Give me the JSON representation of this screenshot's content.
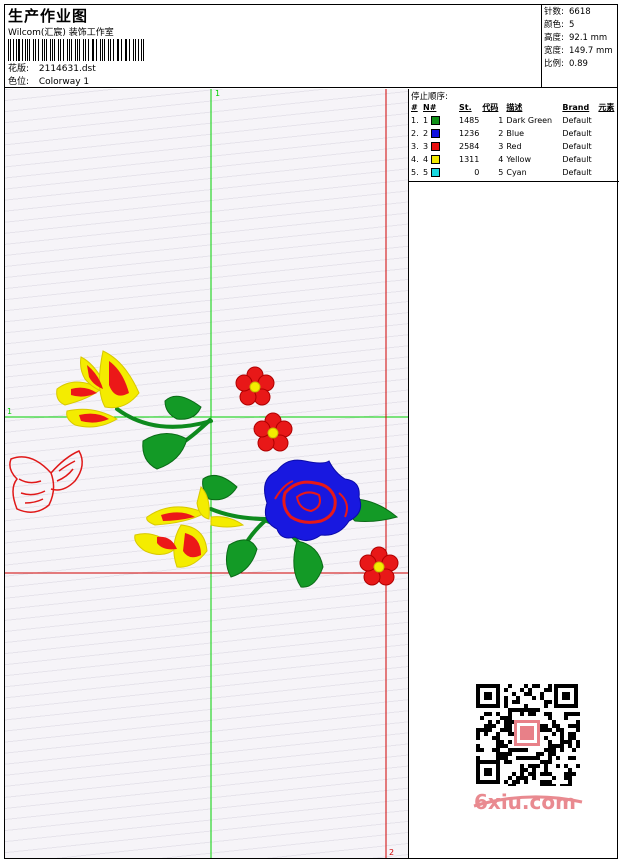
{
  "header": {
    "title": "生产作业图",
    "company": "Wilcom(汇宸) 装饰工作室",
    "design_label": "花版:",
    "design_value": "2114631.dst",
    "colorway_label": "色位:",
    "colorway_value": "Colorway 1"
  },
  "stats": [
    {
      "label": "针数:",
      "value": "6618"
    },
    {
      "label": "颜色:",
      "value": "5"
    },
    {
      "label": "高度:",
      "value": "92.1 mm"
    },
    {
      "label": "宽度:",
      "value": "149.7 mm"
    },
    {
      "label": "比例:",
      "value": "0.89"
    }
  ],
  "stop_sequence": {
    "title": "停止顺序:",
    "columns": [
      "#",
      "N#",
      "St.",
      "代码",
      "描述",
      "Brand",
      "元素"
    ],
    "rows": [
      {
        "idx": "1.",
        "n": "1",
        "color": "#109018",
        "stitches": "1485",
        "code": "1",
        "desc": "Dark Green",
        "brand": "Default"
      },
      {
        "idx": "2.",
        "n": "2",
        "color": "#1010e0",
        "stitches": "1236",
        "code": "2",
        "desc": "Blue",
        "brand": "Default"
      },
      {
        "idx": "3.",
        "n": "3",
        "color": "#e81010",
        "stitches": "2584",
        "code": "3",
        "desc": "Red",
        "brand": "Default"
      },
      {
        "idx": "4.",
        "n": "4",
        "color": "#f0e800",
        "stitches": "1311",
        "code": "4",
        "desc": "Yellow",
        "brand": "Default"
      },
      {
        "idx": "5.",
        "n": "5",
        "color": "#18d8e0",
        "stitches": "0",
        "code": "5",
        "desc": "Cyan",
        "brand": "Default"
      }
    ]
  },
  "guides": {
    "v1_label": "1",
    "h1_label": "1",
    "v2_label": "2"
  },
  "colors": {
    "guide_green": "#00d000",
    "guide_red": "#d00000",
    "watermark": "#e98a90"
  },
  "watermark": {
    "site": "6xiu.com"
  }
}
